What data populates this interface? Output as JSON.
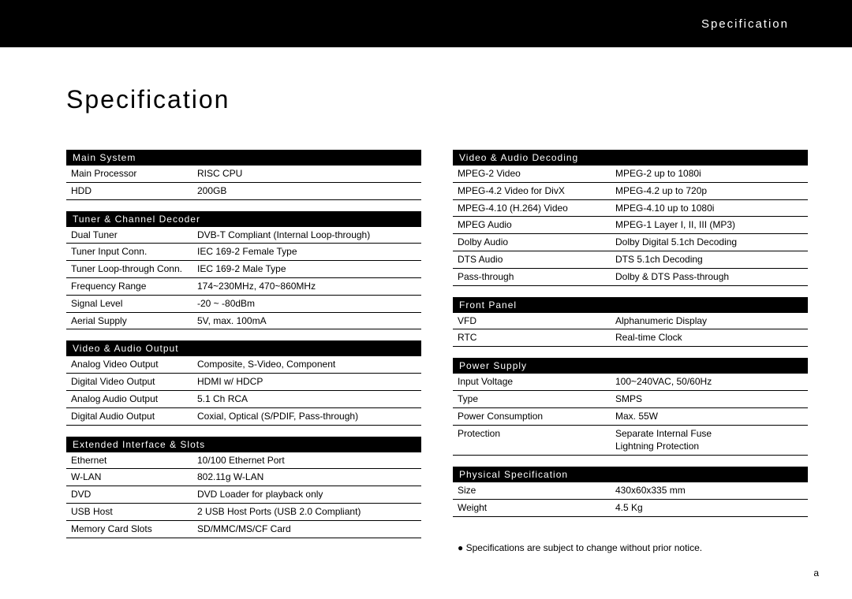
{
  "header": {
    "title": "Specification"
  },
  "page_title": "Specification",
  "footnote": "● Specifications are subject to change without prior notice.",
  "page_corner": "a",
  "left_sections": [
    {
      "title": "Main System",
      "rows": [
        {
          "label": "Main Processor",
          "value": "RISC CPU"
        },
        {
          "label": "HDD",
          "value": "200GB"
        }
      ]
    },
    {
      "title": "Tuner & Channel Decoder",
      "rows": [
        {
          "label": "Dual Tuner",
          "value": "DVB-T Compliant (Internal Loop-through)"
        },
        {
          "label": "Tuner Input Conn.",
          "value": "IEC 169-2 Female Type"
        },
        {
          "label": "Tuner Loop-through Conn.",
          "value": "IEC 169-2 Male Type"
        },
        {
          "label": "Frequency Range",
          "value": "174~230MHz, 470~860MHz"
        },
        {
          "label": "Signal Level",
          "value": "-20 ~ -80dBm"
        },
        {
          "label": "Aerial Supply",
          "value": "5V, max. 100mA"
        }
      ]
    },
    {
      "title": "Video & Audio Output",
      "rows": [
        {
          "label": "Analog Video Output",
          "value": "Composite, S-Video, Component"
        },
        {
          "label": "Digital Video Output",
          "value": "HDMI w/ HDCP"
        },
        {
          "label": "Analog Audio Output",
          "value": "5.1 Ch RCA"
        },
        {
          "label": "Digital Audio Output",
          "value": "Coxial, Optical (S/PDIF, Pass-through)"
        }
      ]
    },
    {
      "title": "Extended Interface & Slots",
      "rows": [
        {
          "label": "Ethernet",
          "value": "10/100 Ethernet Port"
        },
        {
          "label": "W-LAN",
          "value": "802.11g W-LAN"
        },
        {
          "label": "DVD",
          "value": "DVD Loader for playback only"
        },
        {
          "label": "USB Host",
          "value": "2 USB Host Ports (USB 2.0 Compliant)"
        },
        {
          "label": "Memory Card Slots",
          "value": "SD/MMC/MS/CF Card"
        }
      ]
    }
  ],
  "right_sections": [
    {
      "title": "Video & Audio Decoding",
      "rows": [
        {
          "label": "MPEG-2 Video",
          "value": "MPEG-2 up to 1080i"
        },
        {
          "label": "MPEG-4.2 Video for DivX",
          "value": "MPEG-4.2 up to 720p"
        },
        {
          "label": "MPEG-4.10 (H.264) Video",
          "value": "MPEG-4.10 up to 1080i"
        },
        {
          "label": "MPEG Audio",
          "value": "MPEG-1 Layer I, II, III (MP3)"
        },
        {
          "label": "Dolby Audio",
          "value": "Dolby Digital 5.1ch Decoding"
        },
        {
          "label": "DTS Audio",
          "value": "DTS 5.1ch Decoding"
        },
        {
          "label": "Pass-through",
          "value": "Dolby & DTS Pass-through"
        }
      ]
    },
    {
      "title": "Front Panel",
      "rows": [
        {
          "label": "VFD",
          "value": "Alphanumeric Display"
        },
        {
          "label": "RTC",
          "value": "Real-time Clock"
        }
      ]
    },
    {
      "title": "Power Supply",
      "rows": [
        {
          "label": "Input Voltage",
          "value": "100~240VAC, 50/60Hz"
        },
        {
          "label": "Type",
          "value": "SMPS"
        },
        {
          "label": "Power Consumption",
          "value": "Max. 55W"
        },
        {
          "label": "Protection",
          "value": "Separate Internal Fuse\nLightning Protection"
        }
      ]
    },
    {
      "title": "Physical Specification",
      "rows": [
        {
          "label": "Size",
          "value": "430x60x335 mm"
        },
        {
          "label": "Weight",
          "value": "4.5 Kg"
        }
      ]
    }
  ]
}
